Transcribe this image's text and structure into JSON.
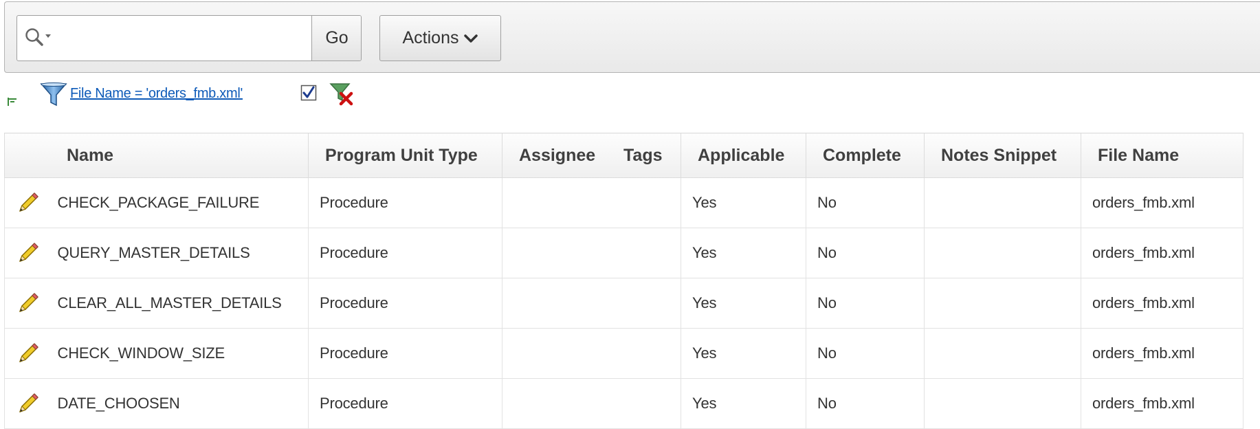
{
  "toolbar": {
    "search_placeholder": "",
    "search_value": "",
    "go_label": "Go",
    "actions_label": "Actions"
  },
  "filter": {
    "text": "File Name = 'orders_fmb.xml'",
    "enabled": true
  },
  "table": {
    "columns": [
      "Name",
      "Program Unit Type",
      "Assignee",
      "Tags",
      "Applicable",
      "Complete",
      "Notes Snippet",
      "File Name"
    ],
    "rows": [
      {
        "name": "CHECK_PACKAGE_FAILURE",
        "type": "Procedure",
        "assignee": "",
        "tags": "",
        "applicable": "Yes",
        "complete": "No",
        "notes": "",
        "file": "orders_fmb.xml"
      },
      {
        "name": "QUERY_MASTER_DETAILS",
        "type": "Procedure",
        "assignee": "",
        "tags": "",
        "applicable": "Yes",
        "complete": "No",
        "notes": "",
        "file": "orders_fmb.xml"
      },
      {
        "name": "CLEAR_ALL_MASTER_DETAILS",
        "type": "Procedure",
        "assignee": "",
        "tags": "",
        "applicable": "Yes",
        "complete": "No",
        "notes": "",
        "file": "orders_fmb.xml"
      },
      {
        "name": "CHECK_WINDOW_SIZE",
        "type": "Procedure",
        "assignee": "",
        "tags": "",
        "applicable": "Yes",
        "complete": "No",
        "notes": "",
        "file": "orders_fmb.xml"
      },
      {
        "name": "DATE_CHOOSEN",
        "type": "Procedure",
        "assignee": "",
        "tags": "",
        "applicable": "Yes",
        "complete": "No",
        "notes": "",
        "file": "orders_fmb.xml"
      }
    ]
  },
  "icons": {
    "search": "search-icon",
    "chevron": "chevron-down-icon",
    "filter": "funnel-icon",
    "remove_filter": "remove-filter-icon",
    "edit": "pencil-icon",
    "collapse": "collapse-icon"
  },
  "colors": {
    "link": "#0d5ab8",
    "funnel": "#2f6fb3",
    "remove": "#cc1111",
    "pencil": "#e8c21c"
  }
}
